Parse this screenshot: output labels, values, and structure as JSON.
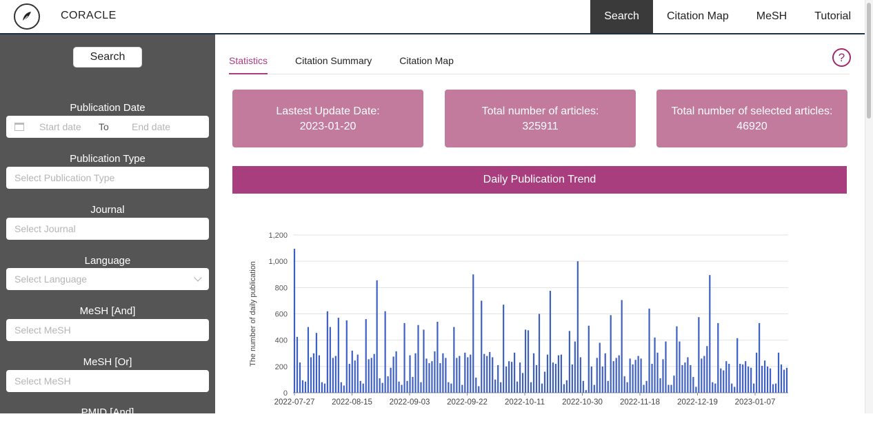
{
  "header": {
    "brand": "CORACLE",
    "nav": [
      "Search",
      "Citation Map",
      "MeSH",
      "Tutorial"
    ],
    "active_nav": "Search"
  },
  "sidebar": {
    "search_button": "Search",
    "publication_date": {
      "label": "Publication Date",
      "start_placeholder": "Start date",
      "to": "To",
      "end_placeholder": "End date"
    },
    "publication_type": {
      "label": "Publication Type",
      "placeholder": "Select Publication Type"
    },
    "journal": {
      "label": "Journal",
      "placeholder": "Select Journal"
    },
    "language": {
      "label": "Language",
      "placeholder": "Select Language"
    },
    "mesh_and": {
      "label": "MeSH [And]",
      "placeholder": "Select MeSH"
    },
    "mesh_or": {
      "label": "MeSH [Or]",
      "placeholder": "Select MeSH"
    },
    "pmid_and": {
      "label": "PMID [And]"
    }
  },
  "main": {
    "tabs": [
      "Statistics",
      "Citation Summary",
      "Citation Map"
    ],
    "active_tab": "Statistics",
    "help_glyph": "?",
    "cards": [
      {
        "label": "Lastest Update Date:",
        "value": "2023-01-20"
      },
      {
        "label": "Total number of articles:",
        "value": "325911"
      },
      {
        "label": "Total number of selected articles:",
        "value": "46920"
      }
    ],
    "chart_title": "Daily Publication Trend"
  },
  "colors": {
    "accent": "#a83e7e",
    "card": "#c27a9d",
    "sidebar": "#555555",
    "bar": "#3d5fc4"
  },
  "chart_data": {
    "type": "bar",
    "title": "Daily Publication Trend",
    "xlabel": "",
    "ylabel": "The number of daily publication",
    "ylim": [
      0,
      1200
    ],
    "yticks": [
      "0",
      "200",
      "400",
      "600",
      "800",
      "1,000",
      "1,200"
    ],
    "x_tick_labels": [
      "2022-07-27",
      "2022-08-15",
      "2022-09-03",
      "2022-09-22",
      "2022-10-11",
      "2022-10-30",
      "2022-11-18",
      "2022-12-19",
      "2023-01-07"
    ],
    "grid": true,
    "values": [
      1095,
      425,
      230,
      95,
      85,
      500,
      270,
      300,
      455,
      285,
      80,
      70,
      620,
      500,
      265,
      280,
      570,
      80,
      55,
      550,
      220,
      320,
      245,
      290,
      90,
      70,
      560,
      255,
      265,
      295,
      855,
      110,
      75,
      620,
      125,
      190,
      275,
      315,
      85,
      60,
      530,
      90,
      285,
      120,
      300,
      515,
      80,
      480,
      260,
      225,
      240,
      315,
      540,
      225,
      300,
      265,
      80,
      70,
      500,
      265,
      280,
      60,
      305,
      270,
      290,
      900,
      115,
      50,
      700,
      295,
      280,
      310,
      270,
      100,
      210,
      80,
      670,
      200,
      240,
      235,
      305,
      85,
      230,
      150,
      480,
      475,
      80,
      300,
      210,
      600,
      70,
      160,
      290,
      775,
      230,
      220,
      285,
      290,
      65,
      95,
      470,
      215,
      390,
      1000,
      270,
      90,
      20,
      510,
      200,
      60,
      265,
      380,
      200,
      300,
      90,
      590,
      240,
      265,
      285,
      705,
      125,
      80,
      260,
      215,
      250,
      280,
      260,
      60,
      90,
      640,
      220,
      420,
      305,
      110,
      255,
      390,
      60,
      60,
      130,
      505,
      390,
      210,
      230,
      270,
      210,
      120,
      45,
      575,
      260,
      280,
      355,
      895,
      80,
      70,
      530,
      185,
      170,
      240,
      220,
      70,
      45,
      415,
      220,
      215,
      240,
      200,
      190,
      70,
      305,
      530,
      205,
      245,
      200,
      185,
      65,
      70,
      305,
      215,
      175,
      190
    ]
  }
}
